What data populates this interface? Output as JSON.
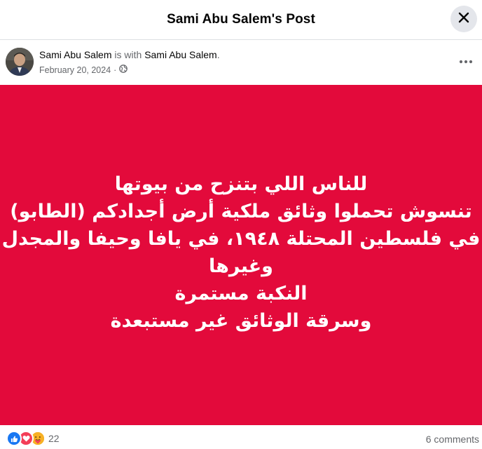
{
  "header": {
    "title": "Sami Abu Salem's Post"
  },
  "author": {
    "name": "Sami Abu Salem",
    "with_text": "is with",
    "tagged_name": "Sami Abu Salem",
    "period": ".",
    "date": "February 20, 2024",
    "separator": "·",
    "privacy_icon": "globe-icon"
  },
  "post": {
    "background_color": "#e30a3b",
    "lines": [
      "للناس اللي بتنزح من بيوتها",
      "تنسوش تحملوا وثائق ملكية أرض أجدادكم (الطابو)",
      "في فلسطين المحتلة ١٩٤٨، في يافا وحيفا والمجدل",
      "وغيرها",
      "النكبة مستمرة",
      "وسرقة الوثائق غير مستبعدة"
    ]
  },
  "footer": {
    "reaction_icons": [
      "like-icon",
      "love-icon",
      "care-icon"
    ],
    "reaction_count": "22",
    "comments_label": "6 comments"
  }
}
